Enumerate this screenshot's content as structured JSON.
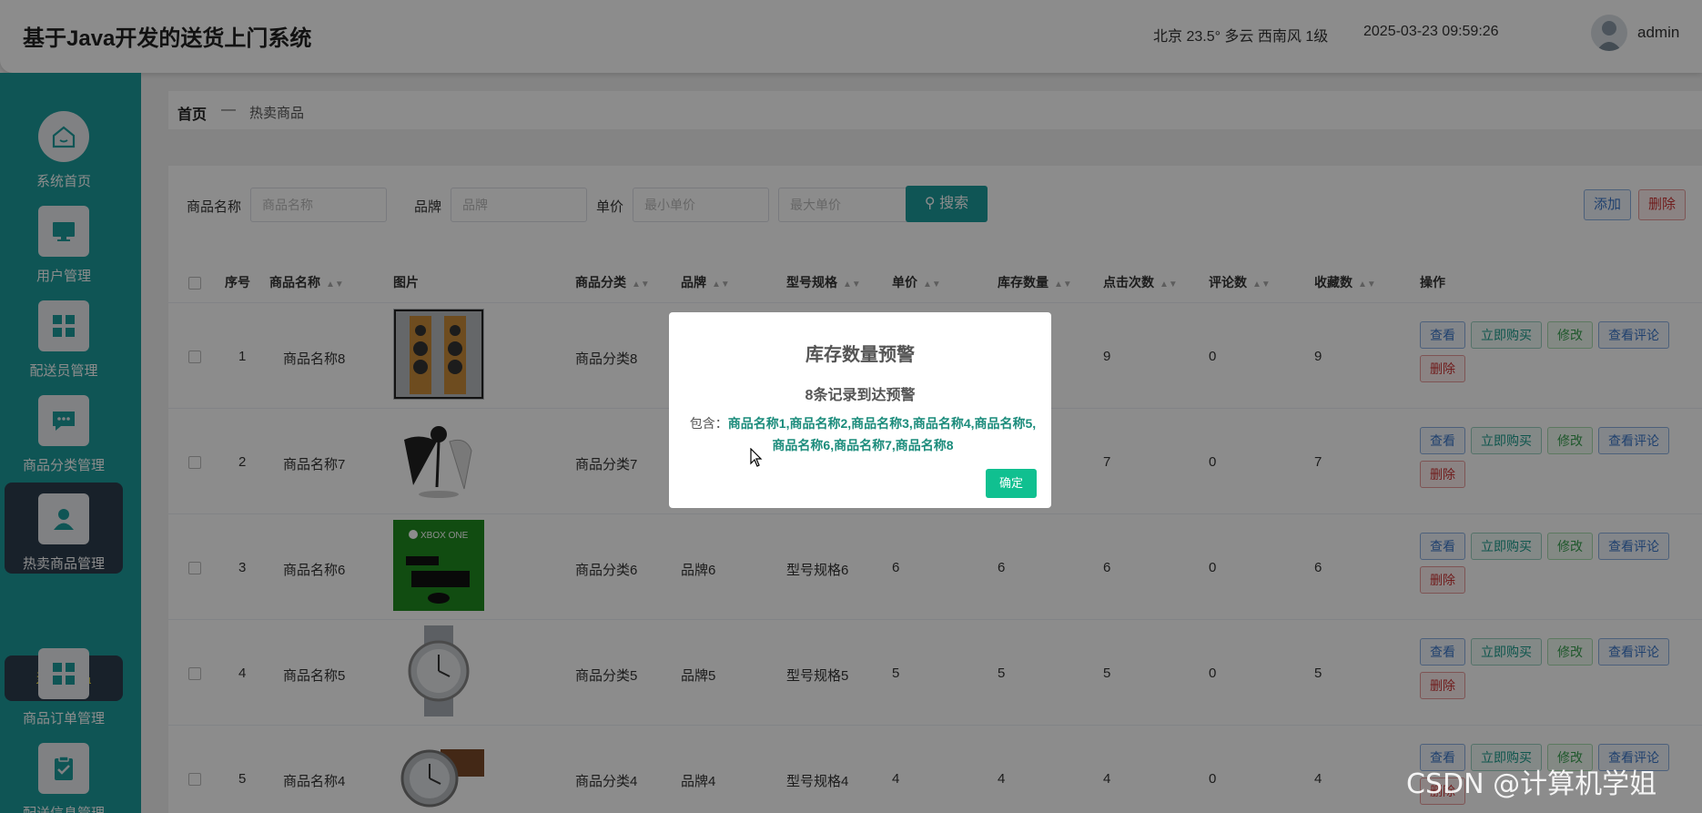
{
  "header": {
    "title": "基于Java开发的送货上门系统",
    "weather": "北京  23.5°  多云  西南风  1级",
    "datetime": "2025-03-23 09:59:26",
    "username": "admin"
  },
  "sidebar": {
    "items": [
      {
        "label": "系统首页",
        "icon": "home-icon"
      },
      {
        "label": "用户管理",
        "icon": "monitor-icon"
      },
      {
        "label": "配送员管理",
        "icon": "grid-icon"
      },
      {
        "label": "商品分类管理",
        "icon": "chat-icon"
      },
      {
        "label": "热卖商品管理",
        "icon": "user-icon"
      },
      {
        "label": "商品订单管理",
        "icon": "grid-icon"
      },
      {
        "label": "配送信息管理",
        "icon": "clipboard-icon"
      }
    ],
    "submenu": "热卖商品"
  },
  "breadcrumb": {
    "home": "首页",
    "separator": "—",
    "current": "热卖商品"
  },
  "search": {
    "name_label": "商品名称",
    "name_placeholder": "商品名称",
    "brand_label": "品牌",
    "brand_placeholder": "品牌",
    "price_label": "单价",
    "min_placeholder": "最小单价",
    "max_placeholder": "最大单价",
    "search_button": "搜索",
    "add_button": "添加",
    "delete_button": "删除"
  },
  "table": {
    "headers": [
      "序号",
      "商品名称",
      "图片",
      "商品分类",
      "品牌",
      "型号规格",
      "单价",
      "库存数量",
      "点击次数",
      "评论数",
      "收藏数",
      "操作"
    ],
    "ops": {
      "view": "查看",
      "buy": "立即购买",
      "edit": "修改",
      "review": "查看评论",
      "remove": "删除"
    },
    "rows": [
      {
        "no": "1",
        "name": "商品名称8",
        "image": "speakers",
        "category": "商品分类8",
        "brand": "",
        "model": "",
        "price": "",
        "stock": "",
        "clicks": "9",
        "comments": "0",
        "favorites": "9"
      },
      {
        "no": "2",
        "name": "商品名称7",
        "image": "earphones",
        "category": "商品分类7",
        "brand": "",
        "model": "",
        "price": "",
        "stock": "",
        "clicks": "7",
        "comments": "0",
        "favorites": "7"
      },
      {
        "no": "3",
        "name": "商品名称6",
        "image": "xbox",
        "category": "商品分类6",
        "brand": "品牌6",
        "model": "型号规格6",
        "price": "6",
        "stock": "6",
        "clicks": "6",
        "comments": "0",
        "favorites": "6"
      },
      {
        "no": "4",
        "name": "商品名称5",
        "image": "watch",
        "category": "商品分类5",
        "brand": "品牌5",
        "model": "型号规格5",
        "price": "5",
        "stock": "5",
        "clicks": "5",
        "comments": "0",
        "favorites": "5"
      },
      {
        "no": "5",
        "name": "商品名称4",
        "image": "leather-watch",
        "category": "商品分类4",
        "brand": "品牌4",
        "model": "型号规格4",
        "price": "4",
        "stock": "4",
        "clicks": "4",
        "comments": "0",
        "favorites": "4"
      }
    ]
  },
  "modal": {
    "title": "库存数量预警",
    "subtitle": "8条记录到达预警",
    "prefix": "包含：",
    "names": "商品名称1,商品名称2,商品名称3,商品名称4,商品名称5,商品名称6,商品名称7,商品名称8",
    "ok_button": "确定"
  },
  "watermark": "CSDN @计算机学姐",
  "colors": {
    "accent": "#1c9c9c",
    "sidebar_active": "#2c3d4e",
    "ok_button": "#10c090"
  }
}
